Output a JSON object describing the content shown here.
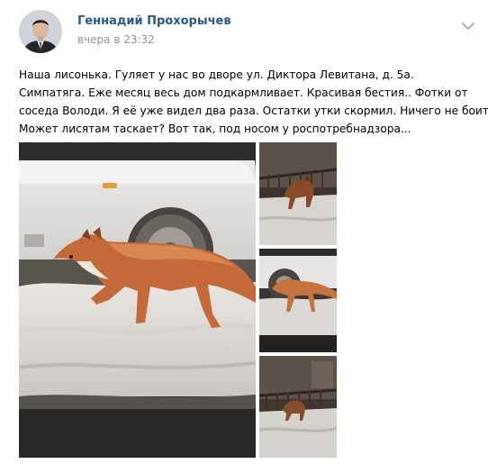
{
  "post": {
    "author": "Геннадий Прохорычев",
    "time": "вчера в 23:32",
    "text_lines": [
      "Наша лисонька. Гуляет у нас во дворе ул. Диктора Левитана, д. 5а.",
      "Симпатяга. Еже месяц весь дом подкармливает. Красивая бестия.. Фотки от",
      "соседа Володи. Я её уже видел два раза. Остатки утки скормил. Ничего не боится.",
      "Может лисятам таскает? Вот так, под носом у роспотребнадзора..."
    ]
  },
  "icons": {
    "menu": "chevron-down-icon",
    "avatar": "avatar"
  },
  "colors": {
    "link": "#2a5885",
    "meta": "#939393",
    "text": "#000000"
  }
}
